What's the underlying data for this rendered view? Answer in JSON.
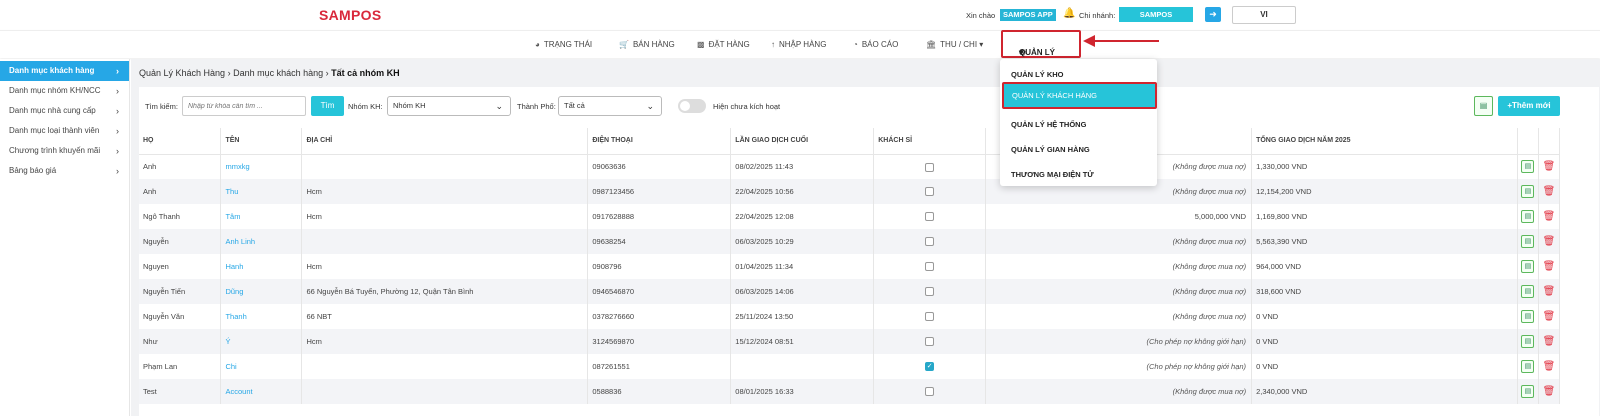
{
  "header": {
    "logo": "SAMPOS",
    "greeting": "Xin chào",
    "app_badge": "SAMPOS APP",
    "branch_label": "Chi nhánh:",
    "branch_value": "SAMPOS",
    "lang": "VI"
  },
  "nav": {
    "items": [
      {
        "icon": "gauge-icon",
        "label": "TRẠNG THÁI"
      },
      {
        "icon": "cart-icon",
        "label": "BÁN HÀNG"
      },
      {
        "icon": "calendar-icon",
        "label": "ĐẶT HÀNG"
      },
      {
        "icon": "upload-icon",
        "label": "NHẬP HÀNG"
      },
      {
        "icon": "pie-chart-icon",
        "label": "BÁO CÁO"
      },
      {
        "icon": "bank-icon",
        "label": "THU / CHI"
      }
    ],
    "active_label": "QUẢN LÝ"
  },
  "dropdown": {
    "items": [
      "QUẢN LÝ KHO",
      "QUẢN LÝ KHÁCH HÀNG",
      "QUẢN LÝ HỆ THỐNG",
      "QUẢN LÝ GIAN HÀNG",
      "THƯƠNG MẠI ĐIỆN TỬ"
    ],
    "selected_index": 1
  },
  "sidebar": {
    "items": [
      {
        "label": "Danh mục khách hàng"
      },
      {
        "label": "Danh mục nhóm KH/NCC"
      },
      {
        "label": "Danh mục nhà cung cấp"
      },
      {
        "label": "Danh mục loại thành viên"
      },
      {
        "label": "Chương trình khuyến mãi"
      },
      {
        "label": "Bảng báo giá"
      }
    ]
  },
  "breadcrumb": {
    "part1": "Quản Lý Khách Hàng",
    "part2": "Danh mục khách hàng",
    "part3": "Tất cả nhóm KH"
  },
  "filters": {
    "search_label": "Tìm kiếm:",
    "search_placeholder": "Nhập từ khóa cần tìm ...",
    "search_button": "Tìm",
    "group_label": "Nhóm KH:",
    "group_value": "Nhóm KH",
    "city_label": "Thành Phố:",
    "city_value": "Tất cả",
    "toggle_label": "Hiện chưa kích hoạt",
    "add_button": "+Thêm mới"
  },
  "table": {
    "headers": {
      "ho": "HỌ",
      "ten": "TÊN",
      "dia_chi": "ĐỊA CHỈ",
      "dien_thoai": "ĐIỆN THOẠI",
      "lan_gd_cuoi": "LẦN GIAO DỊCH CUỐI",
      "khach_si": "KHÁCH SỈ",
      "cong_no": "",
      "tong_gd": "TỔNG GIAO DỊCH NĂM 2025"
    },
    "rows": [
      {
        "ho": "Anh",
        "ten": "mmxkg",
        "dia_chi": "",
        "dien_thoai": "09063636",
        "lan_gd": "08/02/2025 11:43",
        "khach_si": false,
        "cong_no": "(Không được mua nợ)",
        "tong": "1,330,000 VND"
      },
      {
        "ho": "Anh",
        "ten": "Thu",
        "dia_chi": "Hcm",
        "dien_thoai": "0987123456",
        "lan_gd": "22/04/2025 10:56",
        "khach_si": false,
        "cong_no": "(Không được mua nợ)",
        "tong": "12,154,200 VND"
      },
      {
        "ho": "Ngô Thanh",
        "ten": "Tâm",
        "dia_chi": "Hcm",
        "dien_thoai": "0917628888",
        "lan_gd": "22/04/2025 12:08",
        "khach_si": false,
        "cong_no": "5,000,000 VND",
        "tong": "1,169,800 VND"
      },
      {
        "ho": "Nguyễn",
        "ten": "Anh Linh",
        "dia_chi": "",
        "dien_thoai": "09638254",
        "lan_gd": "06/03/2025 10:29",
        "khach_si": false,
        "cong_no": "(Không được mua nợ)",
        "tong": "5,563,390 VND"
      },
      {
        "ho": "Nguyen",
        "ten": "Hanh",
        "dia_chi": "Hcm",
        "dien_thoai": "0908796",
        "lan_gd": "01/04/2025 11:34",
        "khach_si": false,
        "cong_no": "(Không được mua nợ)",
        "tong": "964,000 VND"
      },
      {
        "ho": "Nguyễn Tiến",
        "ten": "Dũng",
        "dia_chi": "66 Nguyễn Bá Tuyển, Phường 12, Quận Tân Bình",
        "dien_thoai": "0946546870",
        "lan_gd": "06/03/2025 14:06",
        "khach_si": false,
        "cong_no": "(Không được mua nợ)",
        "tong": "318,600 VND"
      },
      {
        "ho": "Nguyễn Văn",
        "ten": "Thanh",
        "dia_chi": "66 NBT",
        "dien_thoai": "0378276660",
        "lan_gd": "25/11/2024 13:50",
        "khach_si": false,
        "cong_no": "(Không được mua nợ)",
        "tong": "0 VND"
      },
      {
        "ho": "Như",
        "ten": "Ý",
        "dia_chi": "Hcm",
        "dien_thoai": "3124569870",
        "lan_gd": "15/12/2024 08:51",
        "khach_si": false,
        "cong_no": "(Cho phép nợ không giới hạn)",
        "tong": "0 VND"
      },
      {
        "ho": "Phạm Lan",
        "ten": "Chi",
        "dia_chi": "",
        "dien_thoai": "087261551",
        "lan_gd": "",
        "khach_si": true,
        "cong_no": "(Cho phép nợ không giới hạn)",
        "tong": "0 VND"
      },
      {
        "ho": "Test",
        "ten": "Account",
        "dia_chi": "",
        "dien_thoai": "0588836",
        "lan_gd": "08/01/2025 16:33",
        "khach_si": false,
        "cong_no": "(Không được mua nợ)",
        "tong": "2,340,000 VND"
      }
    ]
  },
  "colors": {
    "brand_red": "#d9283b",
    "accent_cyan": "#26c4d9",
    "accent_blue": "#26a7e6",
    "highlight_red": "#d0252f"
  }
}
